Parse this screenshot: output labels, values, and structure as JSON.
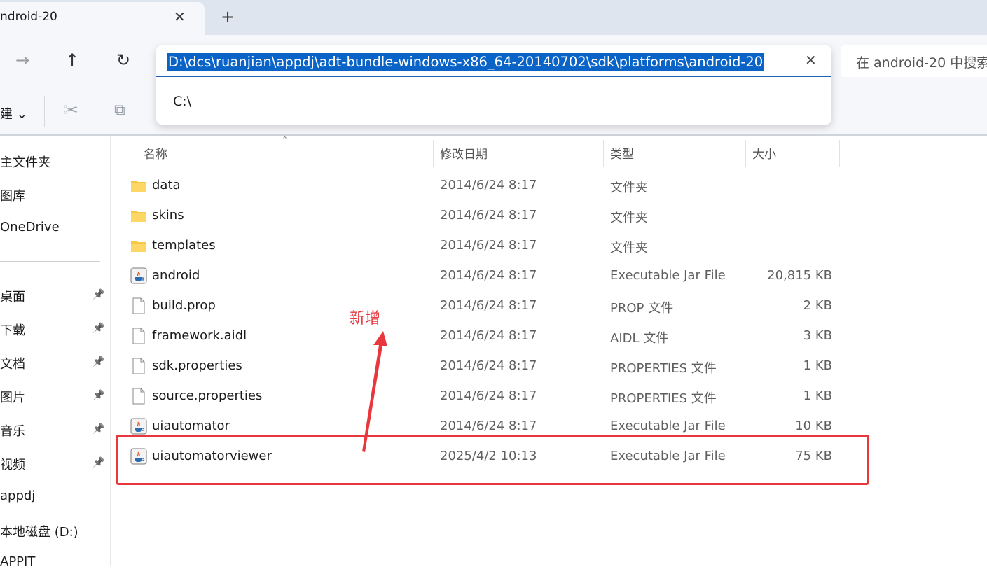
{
  "tab": {
    "title": "ndroid-20",
    "close_icon": "close-icon",
    "new_tab_icon": "plus-icon"
  },
  "nav": {
    "forward_icon": "arrow-right-icon",
    "up_icon": "arrow-up-icon",
    "refresh_icon": "refresh-icon"
  },
  "address": {
    "path": "D:\\dcs\\ruanjian\\appdj\\adt-bundle-windows-x86_64-20140702\\sdk\\platforms\\android-20",
    "suggestion": "C:\\",
    "clear_icon": "close-icon"
  },
  "search": {
    "placeholder": "在 android-20 中搜索"
  },
  "toolbar": {
    "new_label": "建 ⌄",
    "cut_icon": "scissors-icon",
    "copy_icon": "copy-icon"
  },
  "sidebar": {
    "items": [
      {
        "label": "主文件夹",
        "pinned": false
      },
      {
        "label": "图库",
        "pinned": false
      },
      {
        "label": "OneDrive",
        "pinned": false
      },
      {
        "label": "桌面",
        "pinned": true
      },
      {
        "label": "下载",
        "pinned": true
      },
      {
        "label": "文档",
        "pinned": true
      },
      {
        "label": "图片",
        "pinned": true
      },
      {
        "label": "音乐",
        "pinned": true
      },
      {
        "label": "视频",
        "pinned": true
      },
      {
        "label": "appdj",
        "pinned": false
      },
      {
        "label": "本地磁盘 (D:)",
        "pinned": false
      },
      {
        "label": "APPIT",
        "pinned": false
      }
    ]
  },
  "columns": {
    "name": "名称",
    "modified": "修改日期",
    "type": "类型",
    "size": "大小"
  },
  "files": [
    {
      "name": "data",
      "modified": "2014/6/24 8:17",
      "type": "文件夹",
      "size": "",
      "icon": "folder-icon"
    },
    {
      "name": "skins",
      "modified": "2014/6/24 8:17",
      "type": "文件夹",
      "size": "",
      "icon": "folder-icon"
    },
    {
      "name": "templates",
      "modified": "2014/6/24 8:17",
      "type": "文件夹",
      "size": "",
      "icon": "folder-icon"
    },
    {
      "name": "android",
      "modified": "2014/6/24 8:17",
      "type": "Executable Jar File",
      "size": "20,815 KB",
      "icon": "java-jar-icon"
    },
    {
      "name": "build.prop",
      "modified": "2014/6/24 8:17",
      "type": "PROP 文件",
      "size": "2 KB",
      "icon": "file-icon"
    },
    {
      "name": "framework.aidl",
      "modified": "2014/6/24 8:17",
      "type": "AIDL 文件",
      "size": "3 KB",
      "icon": "file-icon"
    },
    {
      "name": "sdk.properties",
      "modified": "2014/6/24 8:17",
      "type": "PROPERTIES 文件",
      "size": "1 KB",
      "icon": "file-icon"
    },
    {
      "name": "source.properties",
      "modified": "2014/6/24 8:17",
      "type": "PROPERTIES 文件",
      "size": "1 KB",
      "icon": "file-icon"
    },
    {
      "name": "uiautomator",
      "modified": "2014/6/24 8:17",
      "type": "Executable Jar File",
      "size": "10 KB",
      "icon": "java-jar-icon"
    },
    {
      "name": "uiautomatorviewer",
      "modified": "2025/4/2 10:13",
      "type": "Executable Jar File",
      "size": "75 KB",
      "icon": "java-jar-icon"
    }
  ],
  "annotation": {
    "text": "新增",
    "color": "#e8373d"
  }
}
